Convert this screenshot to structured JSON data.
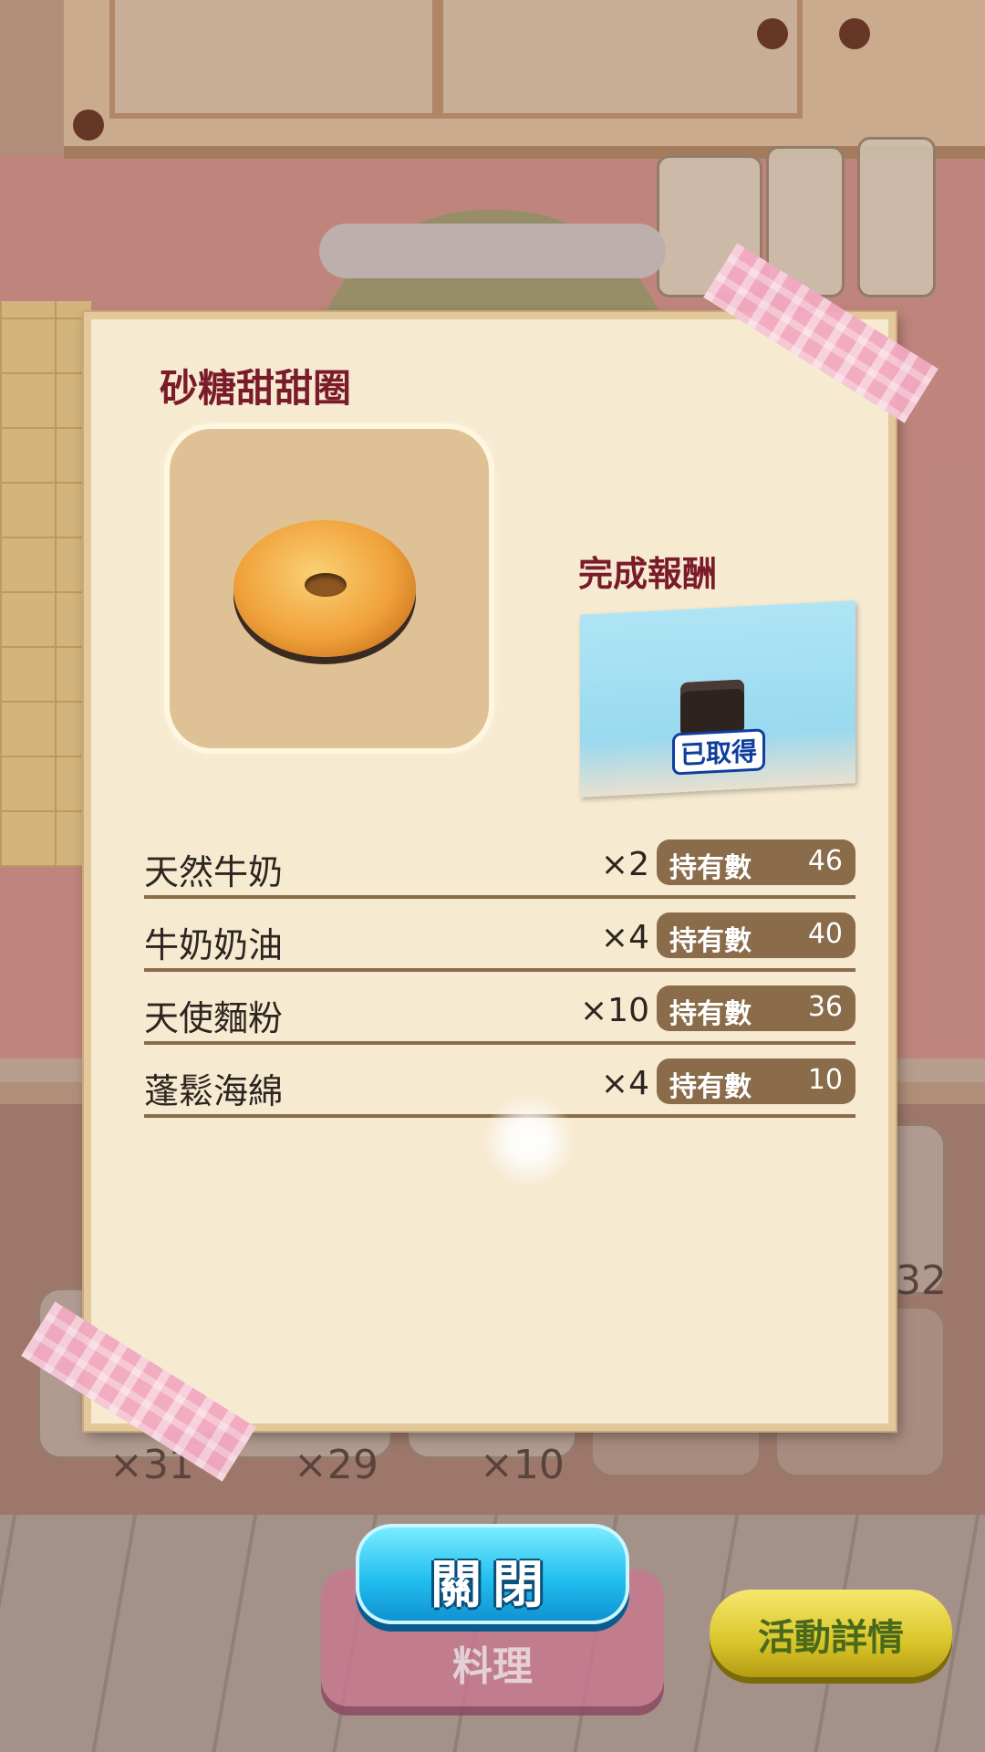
{
  "recipe": {
    "name": "砂糖甜甜圈",
    "image_icon": "glazed-donut-icon"
  },
  "reward": {
    "title": "完成報酬",
    "status": "已取得",
    "item_icon": "gift-box-icon"
  },
  "ingredients": [
    {
      "name": "天然牛奶",
      "qty": "×2",
      "own_label": "持有數",
      "own_count": "46"
    },
    {
      "name": "牛奶奶油",
      "qty": "×4",
      "own_label": "持有數",
      "own_count": "40"
    },
    {
      "name": "天使麵粉",
      "qty": "×10",
      "own_label": "持有數",
      "own_count": "36"
    },
    {
      "name": "蓬鬆海綿",
      "qty": "×4",
      "own_label": "持有數",
      "own_count": "10"
    }
  ],
  "background_slots": [
    {
      "count": "×31"
    },
    {
      "count": "×29"
    },
    {
      "count": "×10"
    },
    {
      "count": "32"
    }
  ],
  "buttons": {
    "close": "關閉",
    "cook": "料理",
    "event_details": "活動詳情"
  },
  "colors": {
    "title": "#7a1b2a",
    "owned_pill": "#8a6c4a",
    "close_button": "#23bff0",
    "event_button": "#d9c52a",
    "card": "#f6ead1"
  }
}
